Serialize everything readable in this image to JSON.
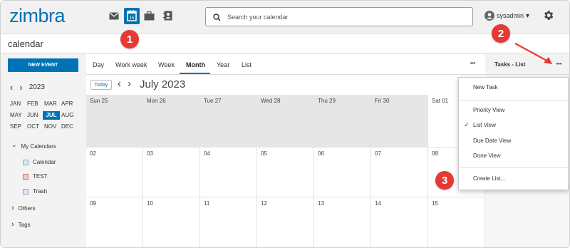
{
  "app": {
    "logo": "zimbra",
    "app_name": "calendar"
  },
  "header": {
    "search_placeholder": "Search your calendar",
    "username": "sysadmin",
    "caret": "▾",
    "gear": "⚙"
  },
  "sidebar": {
    "new_event": "NEW EVENT",
    "year": "2023",
    "prev": "‹",
    "next": "›",
    "months": [
      "JAN",
      "FEB",
      "MAR",
      "APR",
      "MAY",
      "JUN",
      "JUL",
      "AUG",
      "SEP",
      "OCT",
      "NOV",
      "DEC"
    ],
    "selected_month": "JUL",
    "my_calendars": "My Calendars",
    "calendars": [
      "Calendar",
      "TEST",
      "Trash"
    ],
    "others": "Others",
    "tags": "Tags",
    "chev_open": "⌄",
    "chev_closed": "›"
  },
  "views": {
    "items": [
      "Day",
      "Work week",
      "Week",
      "Month",
      "Year",
      "List"
    ],
    "active": "Month",
    "more": "•••"
  },
  "toolbar": {
    "today": "Today",
    "prev": "‹",
    "next": "›",
    "title": "July 2023"
  },
  "calendar": {
    "headers": [
      "Sun 25",
      "Mon 26",
      "Tue 27",
      "Wed 28",
      "Thu 29",
      "Fri 30",
      "Sat 01"
    ],
    "week2": [
      "02",
      "03",
      "04",
      "05",
      "06",
      "07",
      "08"
    ],
    "week3": [
      "09",
      "10",
      "11",
      "12",
      "13",
      "14",
      "15"
    ]
  },
  "tasks": {
    "title": "Tasks - List",
    "more": "•••"
  },
  "menu": {
    "items": [
      "New Task",
      "Priority View",
      "List View",
      "Due Date View",
      "Done View",
      "Create List..."
    ],
    "checked": "List View",
    "check": "✓"
  },
  "annotations": {
    "b1": "1",
    "b2": "2",
    "b3": "3"
  },
  "colors": {
    "accent": "#0073b6",
    "badge": "#e53935"
  }
}
